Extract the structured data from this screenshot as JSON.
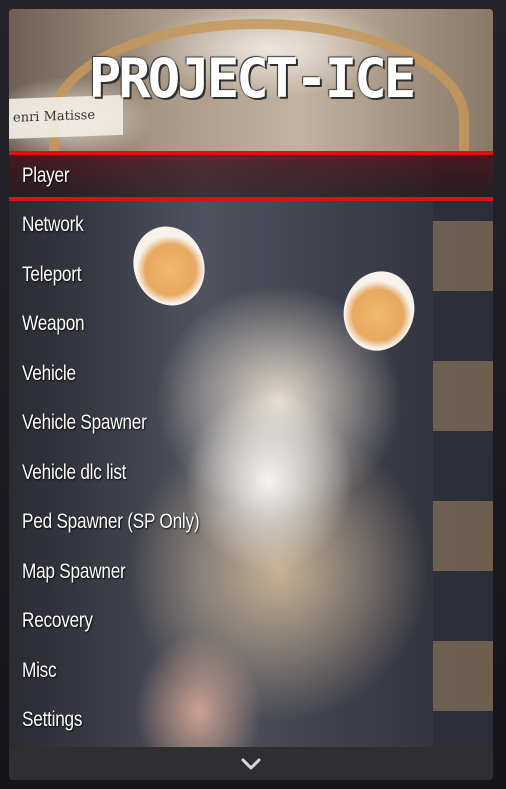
{
  "header": {
    "title": "Project-ice",
    "poster_text": "enri Matisse"
  },
  "menu": {
    "items": [
      {
        "label": "Player",
        "selected": true
      },
      {
        "label": "Network"
      },
      {
        "label": "Teleport"
      },
      {
        "label": "Weapon"
      },
      {
        "label": "Vehicle"
      },
      {
        "label": "Vehicle Spawner"
      },
      {
        "label": "Vehicle dlc list"
      },
      {
        "label": "Ped Spawner (SP Only)"
      },
      {
        "label": "Map Spawner"
      },
      {
        "label": "Recovery"
      },
      {
        "label": "Misc"
      },
      {
        "label": "Settings"
      }
    ]
  },
  "footer": {
    "icon": "chevron-down-icon"
  },
  "colors": {
    "selection_accent": "#e01010",
    "text": "#ffffff",
    "footer_bg": "#2f2e31"
  }
}
